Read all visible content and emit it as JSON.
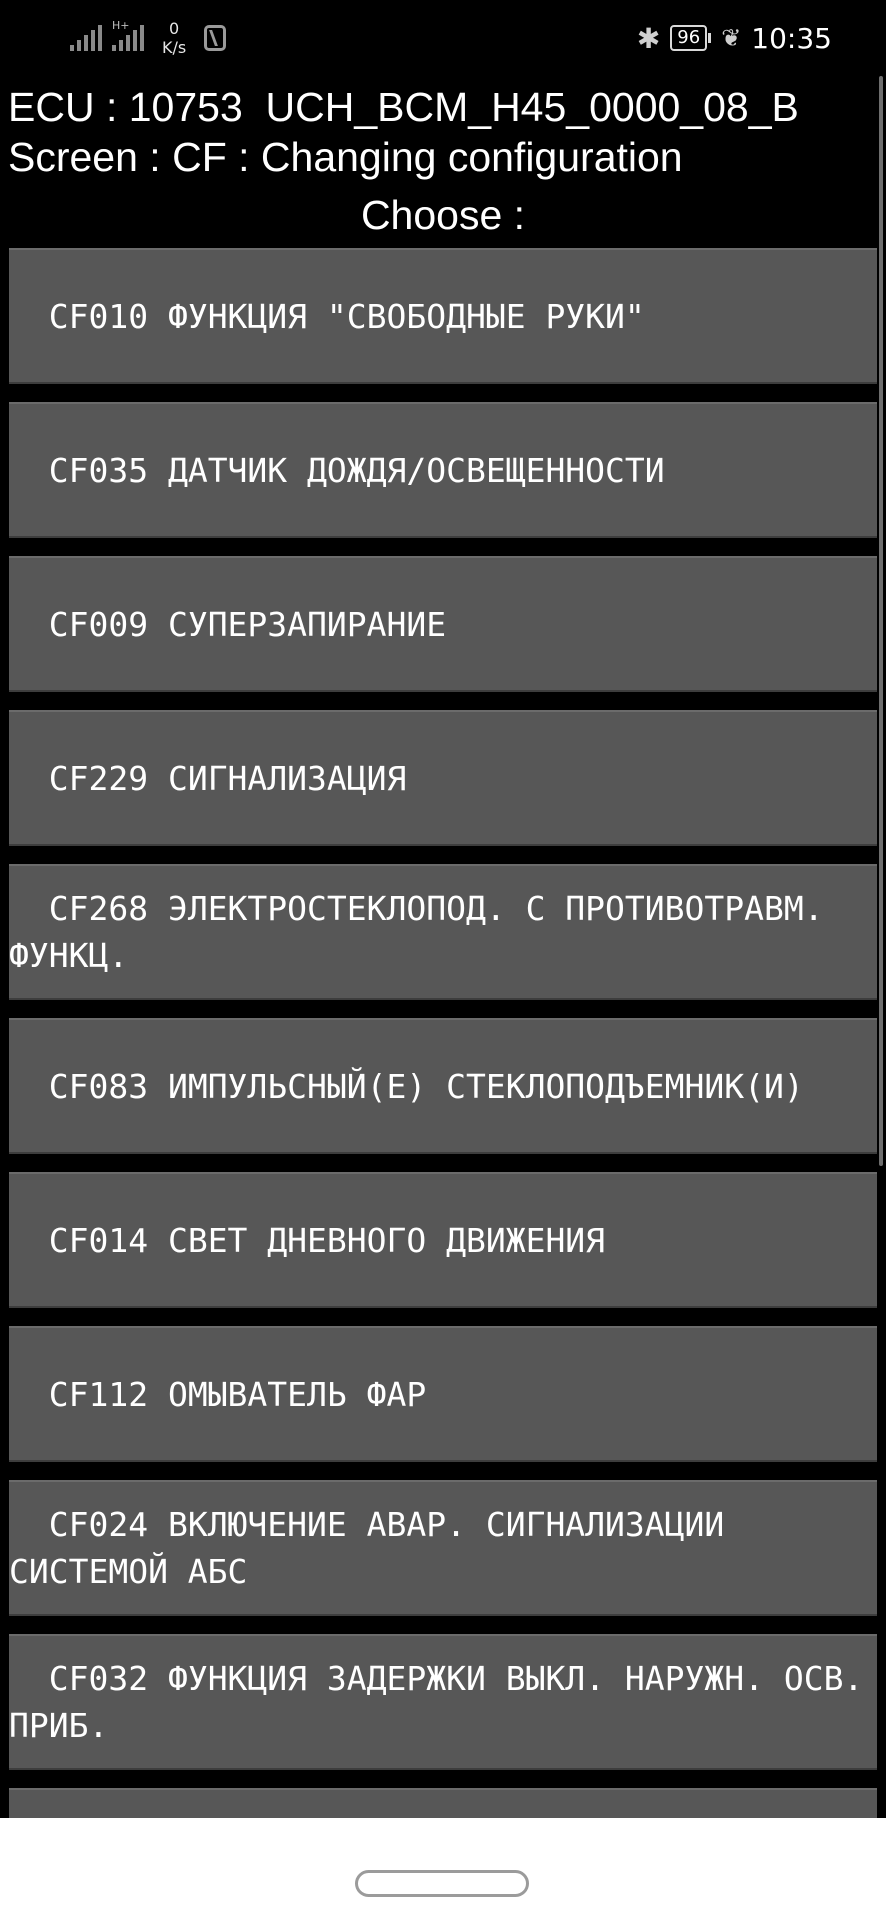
{
  "status_bar": {
    "signal1_icon": "signal-strength-icon",
    "signal2_label": "H+",
    "signal2_icon": "signal-strength-icon",
    "speed_value": "0",
    "speed_unit": "K/s",
    "nfc_icon": "nfc-icon",
    "bluetooth_icon": "bluetooth-icon",
    "battery_level": "96",
    "eco_icon": "leaf-icon",
    "time": "10:35"
  },
  "header": {
    "ecu_line": "ECU : 10753  UCH_BCM_H45_0000_08_B",
    "screen_line": "Screen : CF : Changing configuration",
    "prompt": "Choose :"
  },
  "items": [
    {
      "label": "  CF010 ФУНКЦИЯ \"СВОБОДНЫЕ РУКИ\""
    },
    {
      "label": "  CF035 ДАТЧИК ДОЖДЯ/ОСВЕЩЕННОСТИ"
    },
    {
      "label": "  CF009 СУПЕРЗАПИРАНИЕ"
    },
    {
      "label": "  CF229 СИГНАЛИЗАЦИЯ"
    },
    {
      "label": "  CF268 ЭЛЕКТРОСТЕКЛОПОД. С ПРОТИВОТРАВМ. ФУНКЦ."
    },
    {
      "label": "  CF083 ИМПУЛЬСНЫЙ(Е) СТЕКЛОПОДЪЕМНИК(И)"
    },
    {
      "label": "  CF014 СВЕТ ДНЕВНОГО ДВИЖЕНИЯ"
    },
    {
      "label": "  CF112 ОМЫВАТЕЛЬ ФАР"
    },
    {
      "label": "  CF024 ВКЛЮЧЕНИЕ АВАР. СИГНАЛИЗАЦИИ СИСТЕМОЙ АБС"
    },
    {
      "label": "  CF032 ФУНКЦИЯ ЗАДЕРЖКИ ВЫКЛ. НАРУЖН. ОСВ. ПРИБ."
    }
  ],
  "colors": {
    "background": "#000000",
    "item_background": "#575757",
    "text": "#ffffff",
    "navbar": "#ffffff"
  }
}
